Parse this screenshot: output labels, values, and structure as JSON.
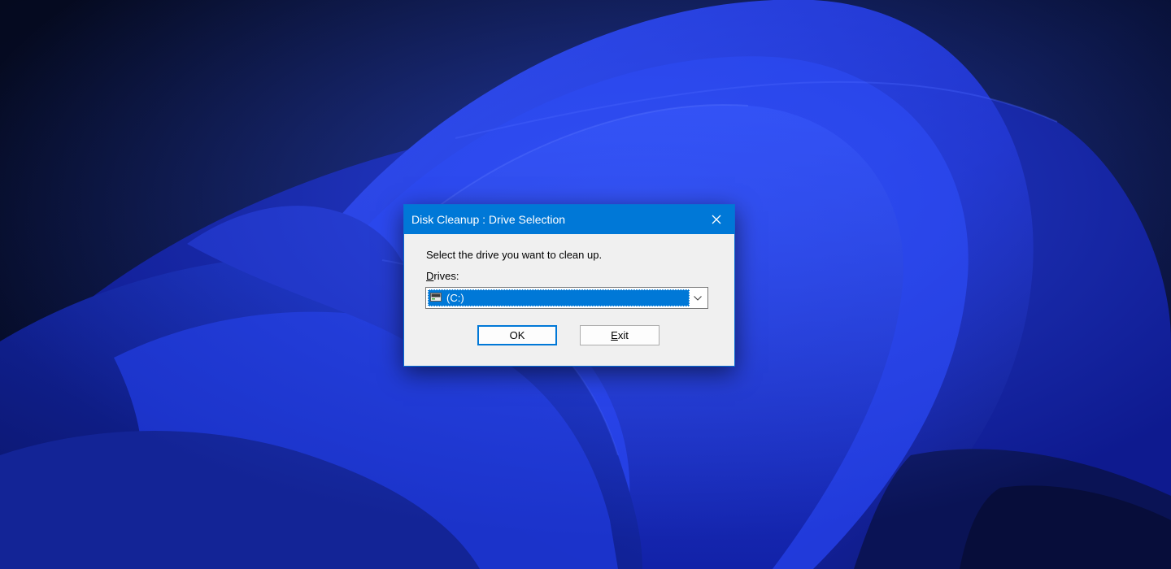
{
  "dialog": {
    "title": "Disk Cleanup : Drive Selection",
    "instruction": "Select the drive you want to clean up.",
    "drives_label_accel": "D",
    "drives_label_rest": "rives:",
    "selected_drive": "(C:)",
    "ok_label": "OK",
    "exit_label_accel": "E",
    "exit_label_rest": "xit"
  },
  "icons": {
    "close": "close-icon",
    "drive": "hard-drive-icon",
    "dropdown": "chevron-down-icon"
  },
  "colors": {
    "titlebar": "#0078d7",
    "selection": "#0078d7",
    "dialog_body": "#f0f0f0",
    "desktop_base": "#060b24",
    "wallpaper_blue": "#1a2fd0"
  }
}
